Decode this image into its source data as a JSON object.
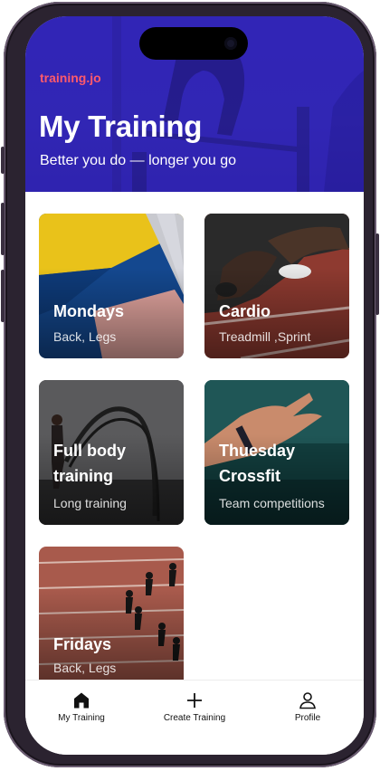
{
  "header": {
    "brand": "training.jo",
    "title": "My Training",
    "subtitle": "Better you do — longer you go"
  },
  "cards": [
    {
      "title": "Mondays",
      "subtitle": "Back, Legs"
    },
    {
      "title": "Cardio",
      "subtitle": "Treadmill ,Sprint"
    },
    {
      "title": "Full body training",
      "subtitle": "Long training"
    },
    {
      "title": "Thuesday Crossfit",
      "subtitle": "Team competitions"
    },
    {
      "title": "Fridays",
      "subtitle": "Back, Legs"
    }
  ],
  "tabbar": {
    "items": [
      {
        "label": "My Training",
        "icon": "home-icon",
        "active": true
      },
      {
        "label": "Create Training",
        "icon": "plus-icon",
        "active": false
      },
      {
        "label": "Profile",
        "icon": "person-icon",
        "active": false
      }
    ]
  },
  "colors": {
    "hero": "#3a2dc8",
    "brand": "#ff5a6b"
  }
}
